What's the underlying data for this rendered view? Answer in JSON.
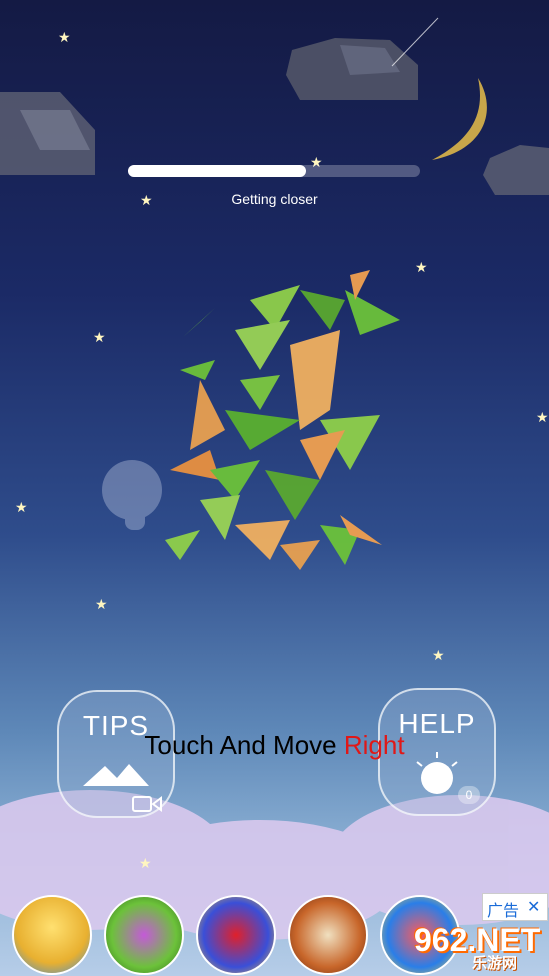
{
  "progress": {
    "fraction": 0.61
  },
  "status_text": "Getting closer",
  "instruction": {
    "prefix": "Touch And Move ",
    "highlight": "Right"
  },
  "tips_button": {
    "label": "TIPS",
    "icon": "mountain-icon",
    "video_icon": "video-icon"
  },
  "help_button": {
    "label": "HELP",
    "icon": "sun-icon",
    "count": "0"
  },
  "ad": {
    "tag": "广告",
    "close": "✕"
  },
  "watermark": {
    "number": "962",
    "suffix": ".NET",
    "sub": "乐游网"
  },
  "games": [
    {
      "name": "motocross-game-icon",
      "color": "#e8b030"
    },
    {
      "name": "snake-game-icon",
      "color": "#6cc23a"
    },
    {
      "name": "block-puzzle-game-icon",
      "color": "#3a4fd8"
    },
    {
      "name": "skeleton-game-icon",
      "color": "#c8662a"
    },
    {
      "name": "bubble-game-icon",
      "color": "#2a7ee8"
    }
  ],
  "colors": {
    "accent_red": "#e01818",
    "shard_green": "#6cc23a",
    "shard_orange": "#f0a050"
  }
}
